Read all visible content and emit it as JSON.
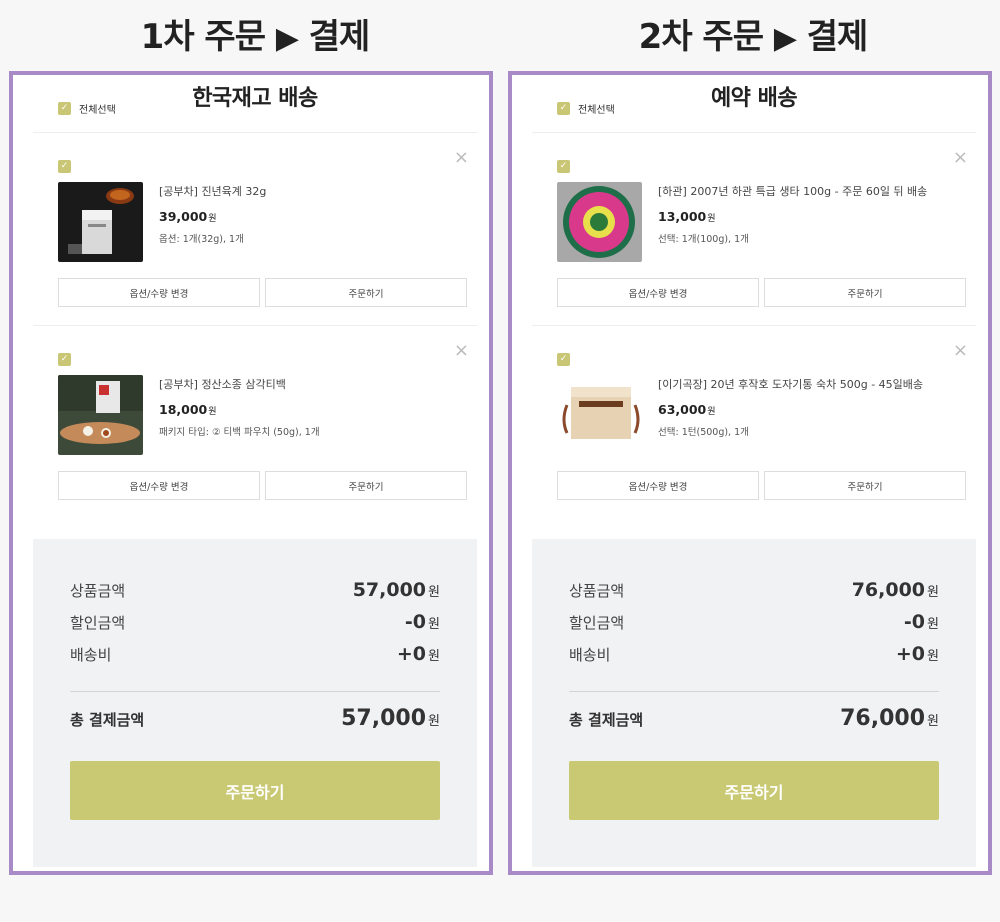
{
  "titles": {
    "left": "1차 주문",
    "right": "2차 주문",
    "arrow": "▶",
    "pay": "결제"
  },
  "left": {
    "group": "한국재고 배송",
    "select_all": "전체선택",
    "items": [
      {
        "name": "[공부차] 진년육계 32g",
        "price": "39,000",
        "option": "옵션: 1개(32g), 1개"
      },
      {
        "name": "[공부차] 정산소종 삼각티백",
        "price": "18,000",
        "option": "패키지 타입: ② 티백 파우치 (50g), 1개"
      }
    ],
    "summary": {
      "product_label": "상품금액",
      "product_value": "57,000",
      "discount_label": "할인금액",
      "discount_value": "-0",
      "shipping_label": "배송비",
      "shipping_value": "+0",
      "total_label": "총 결제금액",
      "total_value": "57,000"
    },
    "order_button": "주문하기"
  },
  "right": {
    "group": "예약 배송",
    "select_all": "전체선택",
    "items": [
      {
        "name": "[하관] 2007년 하관 특급 생타 100g - 주문 60일 뒤 배송",
        "price": "13,000",
        "option": "선택: 1개(100g), 1개"
      },
      {
        "name": "[이기곡장] 20년 후작호 도자기통 숙차 500g - 45일배송",
        "price": "63,000",
        "option": "선택: 1턴(500g), 1개"
      }
    ],
    "summary": {
      "product_label": "상품금액",
      "product_value": "76,000",
      "discount_label": "할인금액",
      "discount_value": "-0",
      "shipping_label": "배송비",
      "shipping_value": "+0",
      "total_label": "총 결제금액",
      "total_value": "76,000"
    },
    "order_button": "주문하기"
  },
  "labels": {
    "change_option": "옵션/수량 변경",
    "order_item": "주문하기",
    "won": "원",
    "close": "×",
    "check": "✓"
  },
  "colors": {
    "frame": "#a88bc6",
    "accent": "#c9c973",
    "summary_bg": "#f1f2f4"
  }
}
